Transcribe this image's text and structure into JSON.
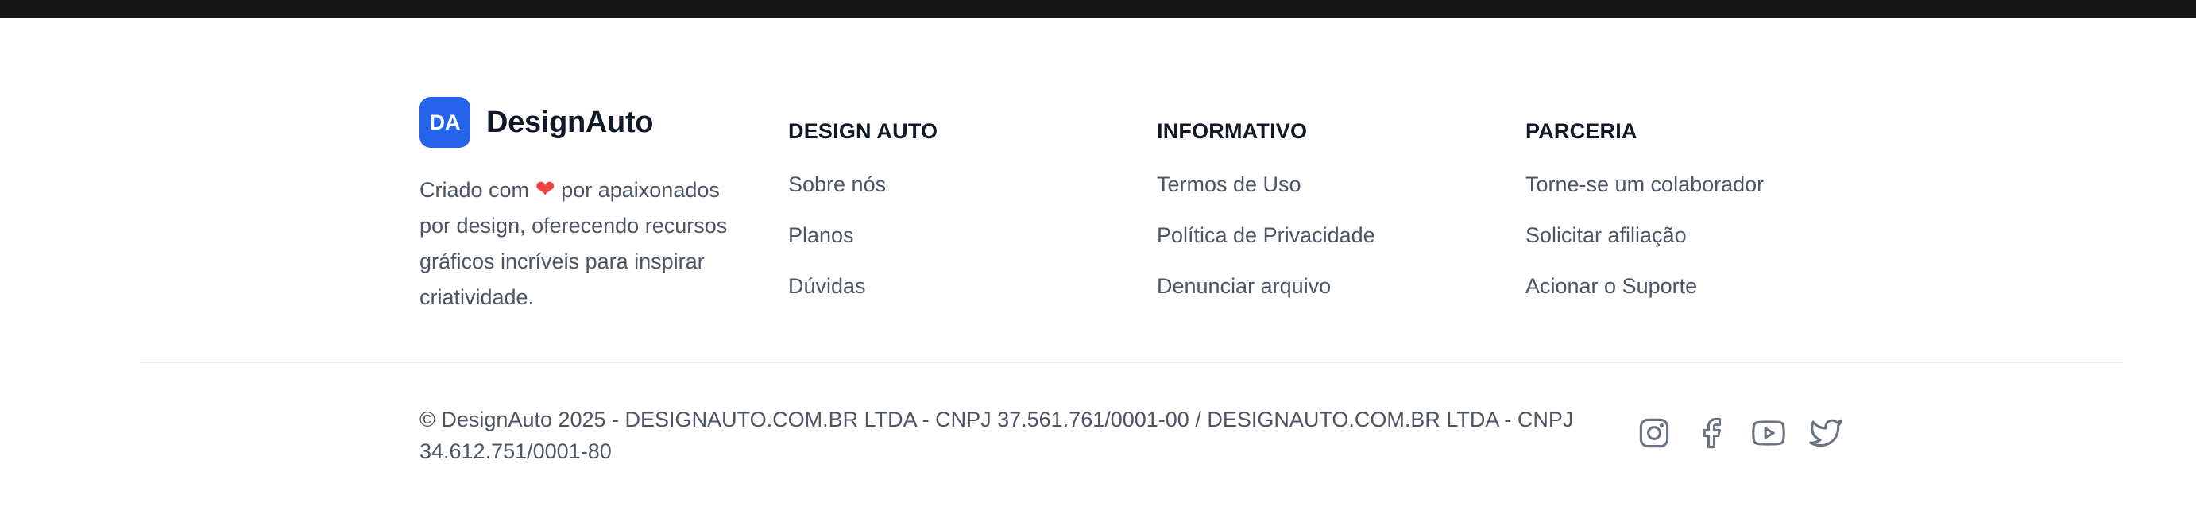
{
  "brand": {
    "logo_initials": "DA",
    "name": "DesignAuto",
    "tagline_before": "Criado com",
    "heart": "❤",
    "tagline_after": "por apaixonados por design, oferecendo recursos gráficos incríveis para inspirar criatividade."
  },
  "columns": [
    {
      "title": "DESIGN AUTO",
      "links": [
        "Sobre nós",
        "Planos",
        "Dúvidas"
      ]
    },
    {
      "title": "INFORMATIVO",
      "links": [
        "Termos de Uso",
        "Política de Privacidade",
        "Denunciar arquivo"
      ]
    },
    {
      "title": "PARCERIA",
      "links": [
        "Torne-se um colaborador",
        "Solicitar afiliação",
        "Acionar o Suporte"
      ]
    }
  ],
  "copyright": "© DesignAuto 2025 - DESIGNAUTO.COM.BR LTDA - CNPJ 37.561.761/0001-00 / DESIGNAUTO.COM.BR LTDA - CNPJ 34.612.751/0001-80",
  "social": [
    "instagram-icon",
    "facebook-icon",
    "youtube-icon",
    "twitter-icon"
  ],
  "colors": {
    "accent": "#2563eb",
    "heart": "#ef4444",
    "topbar": "#161616",
    "heading": "#111827",
    "text": "#4b5563",
    "icon": "#6b7280"
  }
}
